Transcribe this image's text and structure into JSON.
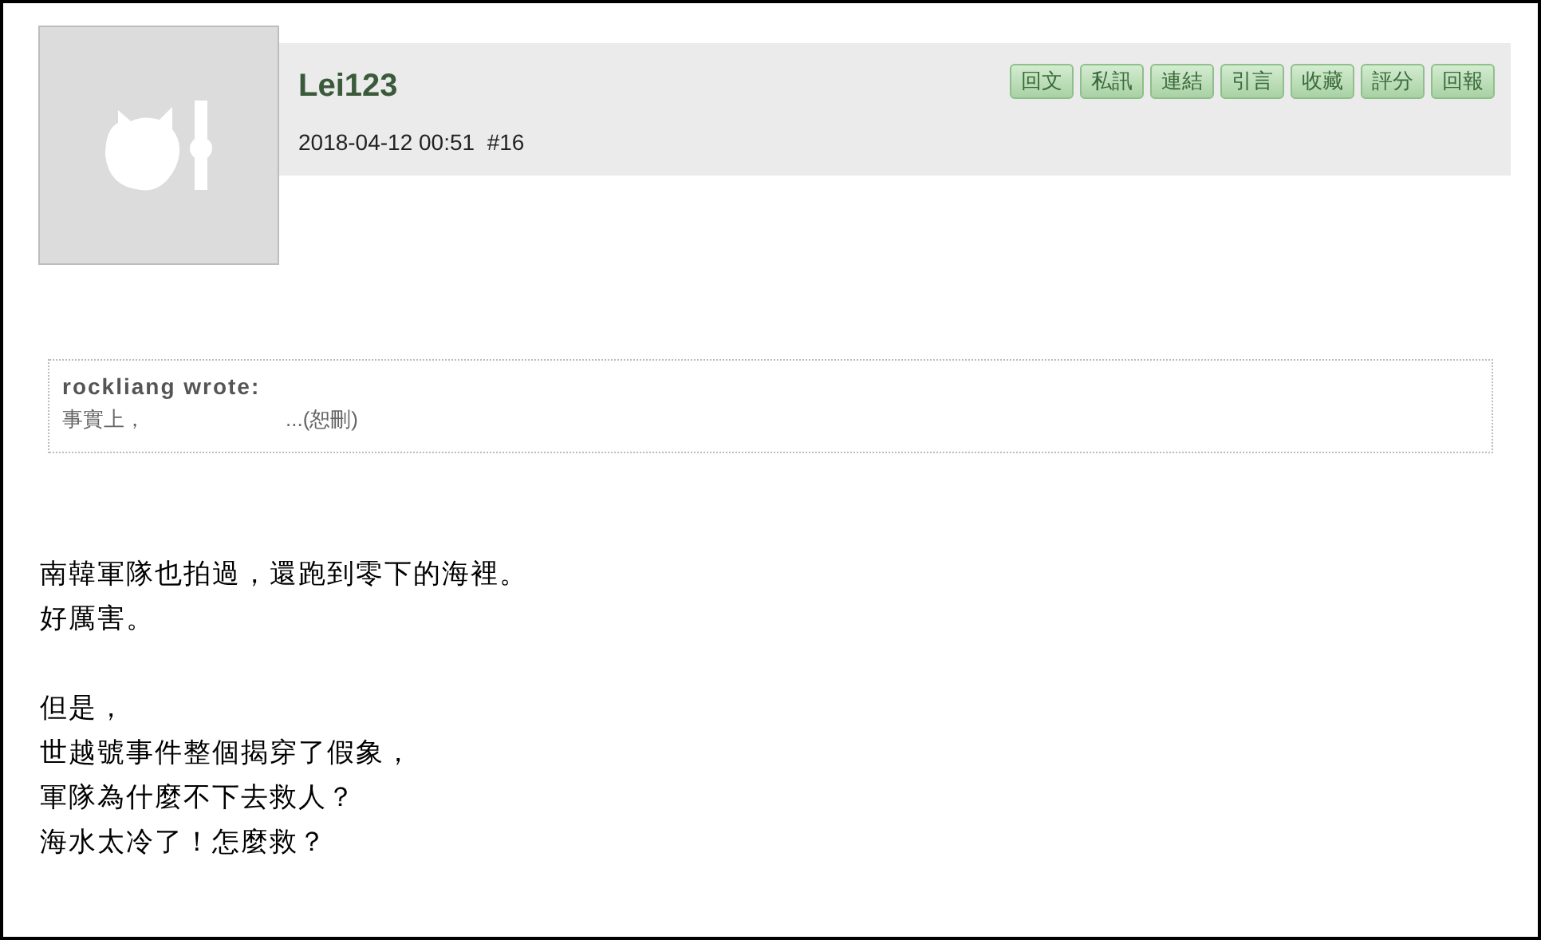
{
  "post": {
    "author": "Lei123",
    "meta": "2018-04-12 00:51  #16",
    "actions": [
      "回文",
      "私訊",
      "連結",
      "引言",
      "收藏",
      "評分",
      "回報"
    ],
    "quote": {
      "author": "rockliang wrote:",
      "start": "事實上，",
      "end": "...(恕刪)"
    },
    "body": [
      [
        "南韓軍隊也拍過，還跑到零下的海裡。",
        "好厲害。"
      ],
      [
        "但是，",
        "世越號事件整個揭穿了假象，",
        "軍隊為什麼不下去救人？",
        "海水太冷了！怎麼救？"
      ]
    ]
  }
}
